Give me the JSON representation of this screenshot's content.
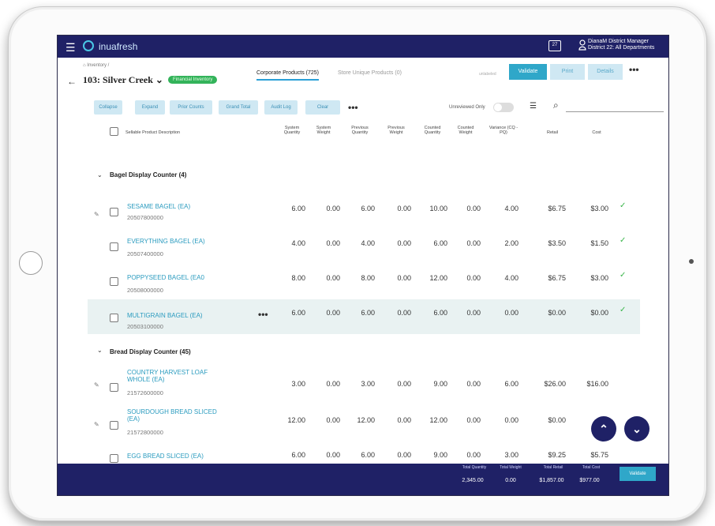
{
  "app": {
    "name": "inuafresh",
    "user_line1": "DianaM District Manager",
    "user_line2": "District 22: All Departments"
  },
  "header": {
    "breadcrumb": "Inventory /",
    "store_title": "103: Silver Creek",
    "badge": "Financial Inventory",
    "tabs": [
      "Corporate Products (725)",
      "Store Unique Products (0)"
    ],
    "small_label": "unlabeled",
    "buttons": {
      "validate": "Validate",
      "print": "Print",
      "details": "Details"
    }
  },
  "toolbar": {
    "buttons": [
      "Collapse",
      "Expand",
      "Prior Counts",
      "Grand Total",
      "Audit Log",
      "Clear"
    ],
    "unreviewed_label": "Unreviewed Only"
  },
  "columns": {
    "description": "Sellable Product Description",
    "system_quantity": "System Quantity",
    "system_weight": "System Weight",
    "previous_quantity": "Previous Quantity",
    "previous_weight": "Previous Weight",
    "counted_quantity": "Counted Quantity",
    "counted_weight": "Counted Weight",
    "variance": "Variance (CQ - PQ)",
    "retail": "Retail",
    "cost": "Cost"
  },
  "groups": [
    {
      "title": "Bagel Display Counter (4)",
      "rows": [
        {
          "name": "SESAME BAGEL (EA)",
          "code": "20507800000",
          "sq": "6.00",
          "sw": "0.00",
          "pq": "6.00",
          "pw": "0.00",
          "cq": "10.00",
          "cw": "0.00",
          "var": "4.00",
          "retail": "$6.75",
          "cost": "$3.00",
          "check": "✓"
        },
        {
          "name": "EVERYTHING BAGEL (EA)",
          "code": "20507400000",
          "sq": "4.00",
          "sw": "0.00",
          "pq": "4.00",
          "pw": "0.00",
          "cq": "6.00",
          "cw": "0.00",
          "var": "2.00",
          "retail": "$3.50",
          "cost": "$1.50",
          "check": "✓"
        },
        {
          "name": "POPPYSEED BAGEL (EA0",
          "code": "20508000000",
          "sq": "8.00",
          "sw": "0.00",
          "pq": "8.00",
          "pw": "0.00",
          "cq": "12.00",
          "cw": "0.00",
          "var": "4.00",
          "retail": "$6.75",
          "cost": "$3.00",
          "check": "✓"
        },
        {
          "name": "MULTIGRAIN BAGEL (EA)",
          "code": "20503100000",
          "sq": "6.00",
          "sw": "0.00",
          "pq": "6.00",
          "pw": "0.00",
          "cq": "6.00",
          "cw": "0.00",
          "var": "0.00",
          "retail": "$0.00",
          "cost": "$0.00",
          "check": "✓"
        }
      ]
    },
    {
      "title": "Bread Display Counter (45)",
      "rows": [
        {
          "name1": "COUNTRY HARVEST LOAF",
          "name2": "WHOLE (EA)",
          "code": "21572600000",
          "sq": "3.00",
          "sw": "0.00",
          "pq": "3.00",
          "pw": "0.00",
          "cq": "9.00",
          "cw": "0.00",
          "var": "6.00",
          "retail": "$26.00",
          "cost": "$16.00"
        },
        {
          "name1": "SOURDOUGH BREAD SLICED",
          "name2": "(EA)",
          "code": "21572800000",
          "sq": "12.00",
          "sw": "0.00",
          "pq": "12.00",
          "pw": "0.00",
          "cq": "12.00",
          "cw": "0.00",
          "var": "0.00",
          "retail": "$0.00",
          "cost": "$0"
        },
        {
          "name": "EGG BREAD SLICED (EA)",
          "sq": "6.00",
          "sw": "0.00",
          "pq": "6.00",
          "pw": "0.00",
          "cq": "9.00",
          "cw": "0.00",
          "var": "3.00",
          "retail": "$9.25",
          "cost": "$5.75"
        }
      ]
    }
  ],
  "footer": {
    "total_quantity_label": "Total Quantity",
    "total_quantity": "2,345.00",
    "total_weight_label": "Total Weight",
    "total_weight": "0.00",
    "total_retail_label": "Total Retail",
    "total_retail": "$1,857.00",
    "total_cost_label": "Total Cost",
    "total_cost": "$977.00",
    "validate": "Validate"
  }
}
